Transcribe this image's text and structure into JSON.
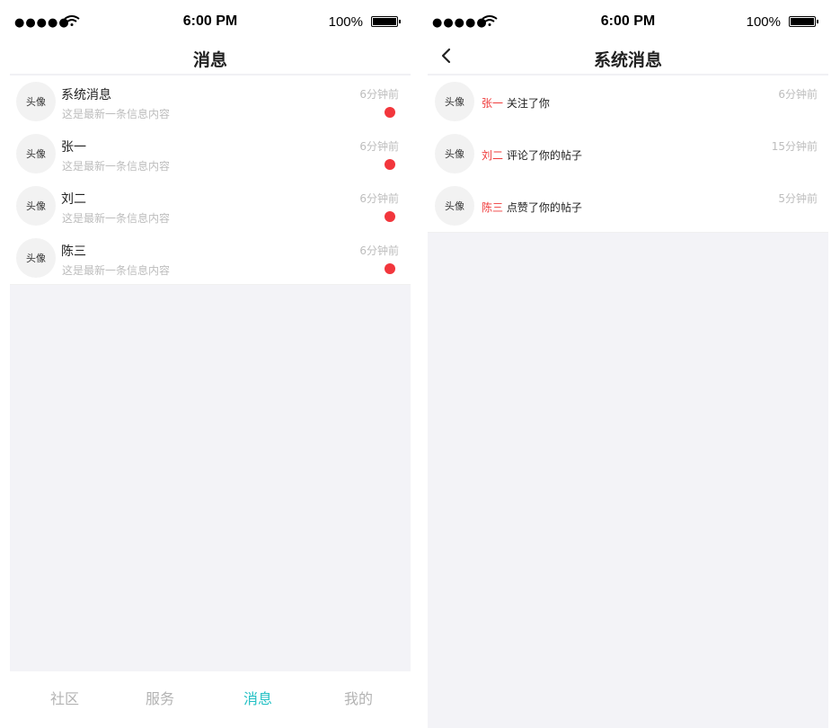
{
  "status_bar": {
    "signal": "●●●●●",
    "time": "6:00 PM",
    "battery": "100%"
  },
  "messages_screen": {
    "title": "消息",
    "conversations": [
      {
        "avatar": "头像",
        "name": "系统消息",
        "preview": "这是最新一条信息内容",
        "time": "6分钟前",
        "unread": true
      },
      {
        "avatar": "头像",
        "name": "张一",
        "preview": "这是最新一条信息内容",
        "time": "6分钟前",
        "unread": true
      },
      {
        "avatar": "头像",
        "name": "刘二",
        "preview": "这是最新一条信息内容",
        "time": "6分钟前",
        "unread": true
      },
      {
        "avatar": "头像",
        "name": "陈三",
        "preview": "这是最新一条信息内容",
        "time": "6分钟前",
        "unread": true
      }
    ],
    "tabs": [
      {
        "label": "社区",
        "active": false
      },
      {
        "label": "服务",
        "active": false
      },
      {
        "label": "消息",
        "active": true
      },
      {
        "label": "我的",
        "active": false
      }
    ],
    "colors": {
      "accent": "#23c0c4",
      "unread_dot": "#f2363c"
    }
  },
  "system_screen": {
    "title": "系统消息",
    "back_icon": "chevron-left-icon",
    "notifications": [
      {
        "avatar": "头像",
        "user": "张一",
        "action": "关注了你",
        "time": "6分钟前"
      },
      {
        "avatar": "头像",
        "user": "刘二",
        "action": "评论了你的帖子",
        "time": "15分钟前"
      },
      {
        "avatar": "头像",
        "user": "陈三",
        "action": "点赞了你的帖子",
        "time": "5分钟前"
      }
    ],
    "colors": {
      "username": "#ef3a3a"
    }
  }
}
